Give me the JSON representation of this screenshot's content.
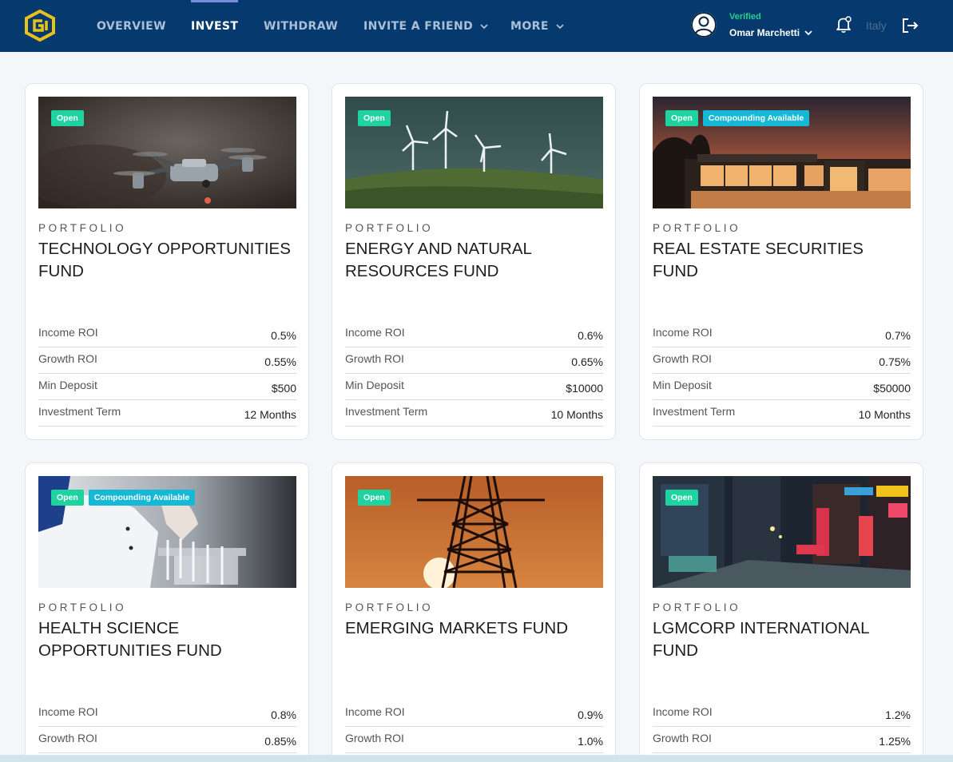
{
  "nav": {
    "logo_icon": "brand-logo-icon",
    "items": [
      {
        "label": "OVERVIEW",
        "active": false
      },
      {
        "label": "INVEST",
        "active": true
      },
      {
        "label": "WITHDRAW",
        "active": false
      },
      {
        "label": "INVITE A FRIEND",
        "active": false
      },
      {
        "label": "MORE",
        "active": false
      }
    ],
    "user": {
      "status": "Verified",
      "name": "Omar Marchetti"
    },
    "country": "Italy",
    "icons": [
      "user-avatar-icon",
      "bell-icon",
      "logout-icon",
      "chevron-down-icon"
    ]
  },
  "colors": {
    "navbar": "#063a6e",
    "open_badge": "#1ed3a0",
    "compounding_badge": "#15b9d6",
    "verified": "#26d08f"
  },
  "cards": [
    {
      "image": "drone",
      "badges": [
        "Open"
      ],
      "category": "PORTFOLIO",
      "title": "TECHNOLOGY OPPORTUNITIES FUND",
      "rows": [
        {
          "label": "Income ROI",
          "value": "0.5%"
        },
        {
          "label": "Growth ROI",
          "value": "0.55%"
        },
        {
          "label": "Min Deposit",
          "value": "$500"
        },
        {
          "label": "Investment Term",
          "value": "12 Months"
        }
      ]
    },
    {
      "image": "wind-turbines",
      "badges": [
        "Open"
      ],
      "category": "PORTFOLIO",
      "title": "ENERGY AND NATURAL RESOURCES FUND",
      "rows": [
        {
          "label": "Income ROI",
          "value": "0.6%"
        },
        {
          "label": "Growth ROI",
          "value": "0.65%"
        },
        {
          "label": "Min Deposit",
          "value": "$10000"
        },
        {
          "label": "Investment Term",
          "value": "10 Months"
        }
      ]
    },
    {
      "image": "modern-house",
      "badges": [
        "Open",
        "Compounding Available"
      ],
      "category": "PORTFOLIO",
      "title": "REAL ESTATE SECURITIES FUND",
      "rows": [
        {
          "label": "Income ROI",
          "value": "0.7%"
        },
        {
          "label": "Growth ROI",
          "value": "0.75%"
        },
        {
          "label": "Min Deposit",
          "value": "$50000"
        },
        {
          "label": "Investment Term",
          "value": "10 Months"
        }
      ]
    },
    {
      "image": "laboratory",
      "badges": [
        "Open",
        "Compounding Available"
      ],
      "category": "PORTFOLIO",
      "title": "HEALTH SCIENCE OPPORTUNITIES FUND",
      "rows": [
        {
          "label": "Income ROI",
          "value": "0.8%"
        },
        {
          "label": "Growth ROI",
          "value": "0.85%"
        }
      ]
    },
    {
      "image": "power-tower-sunset",
      "badges": [
        "Open"
      ],
      "category": "PORTFOLIO",
      "title": "EMERGING MARKETS FUND",
      "rows": [
        {
          "label": "Income ROI",
          "value": "0.9%"
        },
        {
          "label": "Growth ROI",
          "value": "1.0%"
        }
      ]
    },
    {
      "image": "city-street-night",
      "badges": [
        "Open"
      ],
      "category": "PORTFOLIO",
      "title": "LGMCORP INTERNATIONAL FUND",
      "rows": [
        {
          "label": "Income ROI",
          "value": "1.2%"
        },
        {
          "label": "Growth ROI",
          "value": "1.25%"
        }
      ]
    }
  ]
}
